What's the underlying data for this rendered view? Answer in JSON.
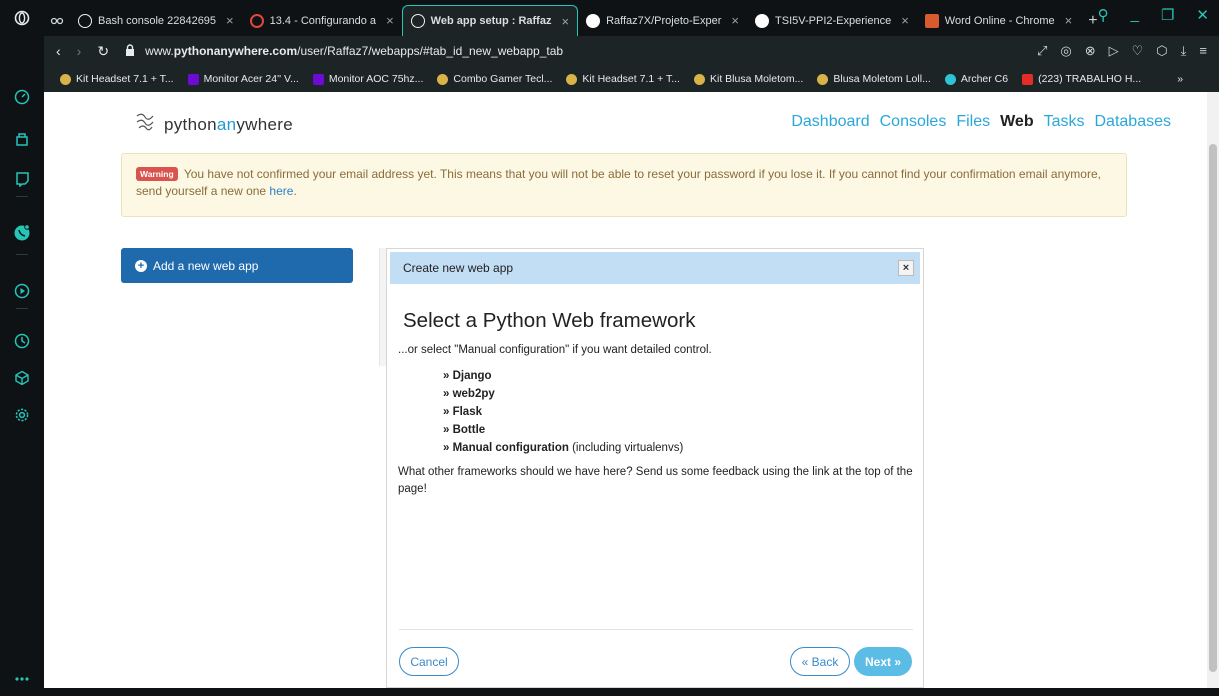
{
  "browser": {
    "tabs": [
      {
        "label": "Bash console 22842695",
        "icon_color": "#f1f1f1",
        "active": false
      },
      {
        "label": "13.4 - Configurando a",
        "icon_color": "#e0483e",
        "active": false
      },
      {
        "label": "Web app setup : Raffaz",
        "icon_color": "#f1f1f1",
        "active": true
      },
      {
        "label": "Raffaz7X/Projeto-Exper",
        "icon_color": "#ffffff",
        "active": false
      },
      {
        "label": "TSI5V-PPI2-Experience",
        "icon_color": "#ffffff",
        "active": false
      },
      {
        "label": "Word Online - Chrome",
        "icon_color": "#d75b2e",
        "active": false
      }
    ],
    "url_prefix": "www.",
    "url_domain": "pythonanywhere.com",
    "url_path": "/user/Raffaz7/webapps/#tab_id_new_webapp_tab",
    "bookmarks": [
      {
        "label": "Kit Headset 7.1 + T...",
        "icon": "generic"
      },
      {
        "label": "Monitor Acer 24'' V...",
        "icon": "olx"
      },
      {
        "label": "Monitor AOC 75hz...",
        "icon": "olx"
      },
      {
        "label": "Combo Gamer Tecl...",
        "icon": "generic"
      },
      {
        "label": "Kit Headset 7.1 + T...",
        "icon": "generic"
      },
      {
        "label": "Kit Blusa Moletom...",
        "icon": "generic"
      },
      {
        "label": "Blusa Moletom Loll...",
        "icon": "generic"
      },
      {
        "label": "Archer C6",
        "icon": "tp"
      },
      {
        "label": "(223) TRABALHO H...",
        "icon": "yt"
      }
    ],
    "bookmarks_overflow": "»"
  },
  "header": {
    "logo_prefix": "python",
    "logo_mid": "an",
    "logo_suffix": "ywhere",
    "nav": [
      {
        "label": "Dashboard",
        "current": false
      },
      {
        "label": "Consoles",
        "current": false
      },
      {
        "label": "Files",
        "current": false
      },
      {
        "label": "Web",
        "current": true
      },
      {
        "label": "Tasks",
        "current": false
      },
      {
        "label": "Databases",
        "current": false
      }
    ]
  },
  "warning": {
    "label": "Warning",
    "text": "You have not confirmed your email address yet. This means that you will not be able to reset your password if you lose it. If you cannot find your confirmation email anymore, send yourself a new one ",
    "link": "here",
    "end": "."
  },
  "sidebar": {
    "add_label": "Add a new web app"
  },
  "modal": {
    "header": "Create new web app",
    "close": "×",
    "title": "Select a Python Web framework",
    "subtitle": "...or select \"Manual configuration\" if you want detailed control.",
    "frameworks": [
      {
        "label": "» Django",
        "note": ""
      },
      {
        "label": "» web2py",
        "note": ""
      },
      {
        "label": "» Flask",
        "note": ""
      },
      {
        "label": "» Bottle",
        "note": ""
      },
      {
        "label": "» Manual configuration",
        "note": " (including virtualenvs)"
      }
    ],
    "feedback": "What other frameworks should we have here? Send us some feedback using the link at the top of the page!",
    "cancel": "Cancel",
    "back": "« Back",
    "next": "Next »"
  },
  "colors": {
    "accent": "#25c6b8",
    "pa_blue": "#2aa7d9",
    "modal_header": "#c2def5",
    "add_button": "#1f69ad"
  }
}
